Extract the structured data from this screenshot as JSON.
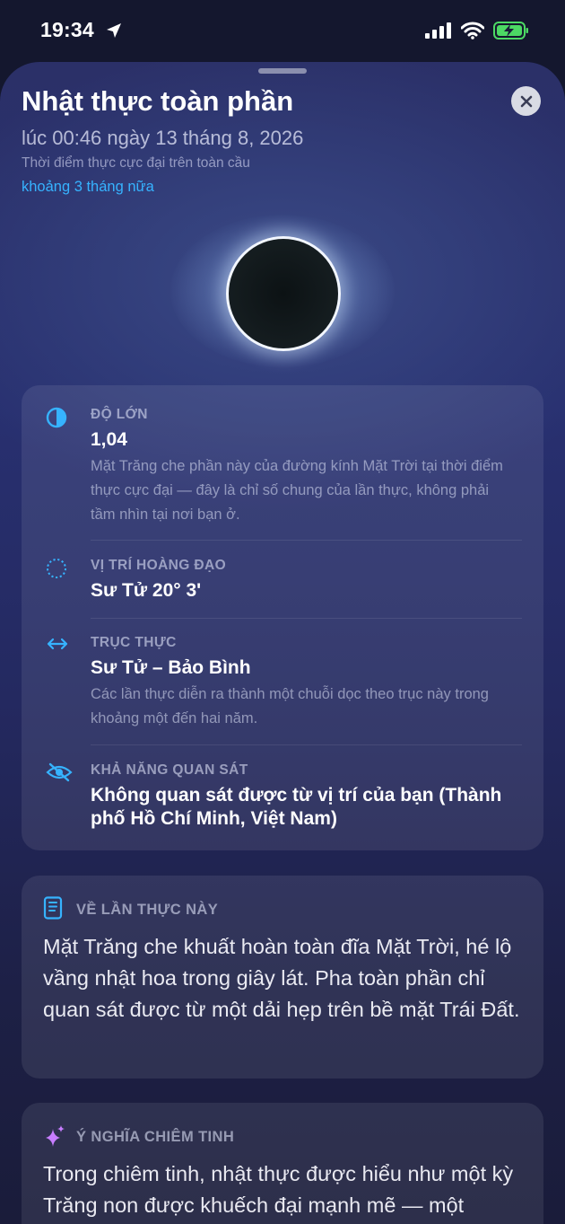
{
  "status_bar": {
    "time": "19:34",
    "icons": [
      "location-arrow-icon",
      "signal-icon",
      "wifi-icon",
      "battery-charging-icon"
    ],
    "battery_color": "#4cd964"
  },
  "sheet": {
    "title": "Nhật thực toàn phần",
    "subtitle": "lúc 00:46 ngày 13 tháng 8, 2026",
    "caption": "Thời điểm thực cực đại trên toàn cầu",
    "relative_time": "khoảng 3 tháng nữa",
    "close_icon": "close-icon"
  },
  "details": [
    {
      "icon": "half-circle-icon",
      "label": "ĐỘ LỚN",
      "value": "1,04",
      "desc": "Mặt Trăng che phần này của đường kính Mặt Trời tại thời điểm thực cực đại — đây là chỉ số chung của lần thực, không phải tầm nhìn tại nơi bạn ở."
    },
    {
      "icon": "dotted-circle-icon",
      "label": "VỊ TRÍ HOÀNG ĐẠO",
      "value": "Sư Tử 20° 3'"
    },
    {
      "icon": "left-right-arrow-icon",
      "label": "TRỤC THỰC",
      "value": "Sư Tử – Bảo Bình",
      "desc": "Các lần thực diễn ra thành một chuỗi dọc theo trục này trong khoảng một đến hai năm."
    },
    {
      "icon": "eye-slash-icon",
      "label": "KHẢ NĂNG QUAN SÁT",
      "value": "Không quan sát được từ vị trí của bạn (Thành phố Hồ Chí Minh, Việt Nam)"
    }
  ],
  "about": {
    "icon": "book-icon",
    "label": "VỀ LẦN THỰC NÀY",
    "body": "Mặt Trăng che khuất hoàn toàn đĩa Mặt Trời, hé lộ vầng nhật hoa trong giây lát. Pha toàn phần chỉ quan sát được từ một dải hẹp trên bề mặt Trái Đất."
  },
  "astro": {
    "icon": "sparkles-icon",
    "label": "Ý NGHĨA CHIÊM TINH",
    "body": "Trong chiêm tinh, nhật thực được hiểu như một kỳ Trăng non được khuếch đại mạnh mẽ — một"
  },
  "colors": {
    "accent": "#36b3ff",
    "sparkle": "#c77dff"
  }
}
